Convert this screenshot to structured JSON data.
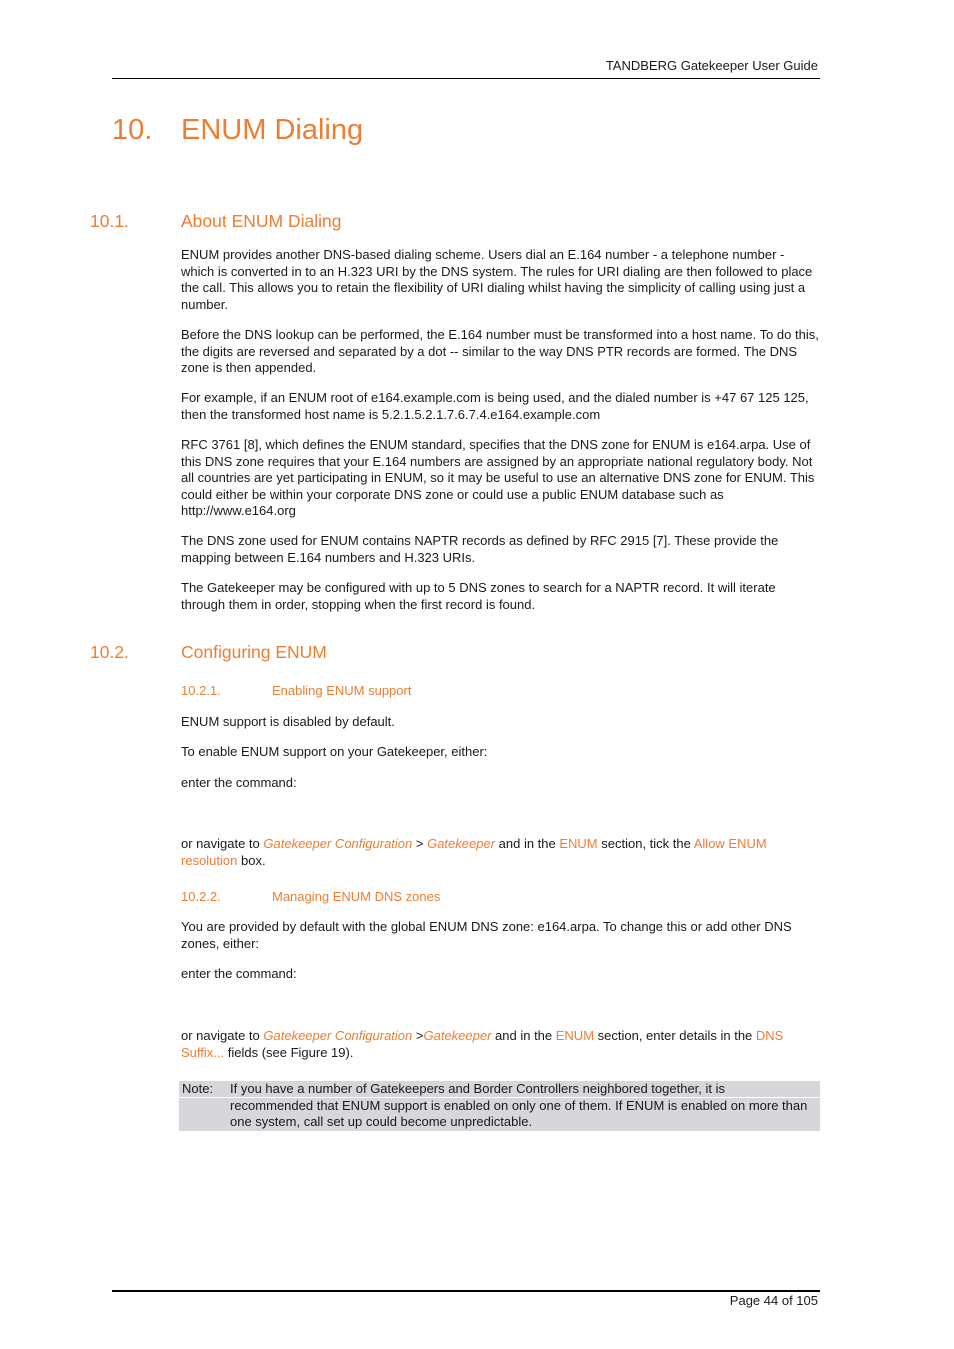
{
  "header": {
    "title": "TANDBERG Gatekeeper User Guide"
  },
  "chapter": {
    "number": "10.",
    "title": "ENUM Dialing"
  },
  "sections": {
    "about": {
      "number": "10.1.",
      "title": "About ENUM Dialing",
      "paragraphs": [
        "ENUM provides another DNS-based dialing scheme. Users dial an E.164 number - a telephone number - which is converted in to an H.323 URI by the DNS system. The rules for URI dialing are then followed to place the call. This allows you to retain the flexibility of URI dialing whilst having the simplicity of calling using just a number.",
        "Before the DNS lookup can be performed, the E.164 number must be transformed into a host name. To do this, the digits are reversed and separated by a dot -- similar to the way DNS PTR records are formed. The DNS zone is then appended.",
        "For example, if an ENUM root of e164.example.com is being used, and the dialed number is +47 67 125 125, then the transformed host name is 5.2.1.5.2.1.7.6.7.4.e164.example.com",
        "RFC 3761 [8], which defines the ENUM standard, specifies that the DNS zone for ENUM is e164.arpa. Use of this DNS zone requires that your E.164 numbers are assigned by an appropriate national regulatory body. Not all countries are yet participating in ENUM, so it may be useful to use an alternative DNS zone for ENUM. This could either be within your corporate DNS zone or could use a public ENUM database such as http://www.e164.org",
        "The DNS zone used for ENUM contains NAPTR records as defined by RFC 2915 [7]. These provide the mapping between E.164 numbers and H.323 URIs.",
        "The Gatekeeper may be configured with up to 5 DNS zones to search for a NAPTR record. It will iterate through them in order, stopping when the first record is found."
      ]
    },
    "configuring": {
      "number": "10.2.",
      "title": "Configuring ENUM",
      "enabling": {
        "number": "10.2.1.",
        "title": "Enabling ENUM support",
        "p1": "ENUM support is disabled by default.",
        "p2": "To enable ENUM support on your Gatekeeper, either:",
        "p3": "enter the command:",
        "nav": {
          "t1": "or navigate to ",
          "link1": "Gatekeeper Configuration",
          "t2": " > ",
          "link2": "Gatekeeper",
          "t3": " and in the ",
          "link3": "ENUM",
          "t4": " section, tick the ",
          "link4": "Allow ENUM resolution",
          "t5": " box."
        }
      },
      "managing": {
        "number": "10.2.2.",
        "title": "Managing ENUM DNS zones",
        "p1": "You are provided by default with the global ENUM DNS zone: e164.arpa. To change this or add other DNS zones, either:",
        "p2": "enter the command:",
        "nav": {
          "t1": "or navigate to ",
          "link1": "Gatekeeper Configuration",
          "t2": " >",
          "link2": "Gatekeeper",
          "t3": " and in the ",
          "link3": "ENUM",
          "t4": " section, enter details in the ",
          "link4": "DNS Suffix...",
          "t5": " fields (see Figure 19)."
        }
      }
    }
  },
  "note": {
    "label": "Note:",
    "lines": [
      "If you have a number of Gatekeepers and Border Controllers neighbored together, it is",
      "recommended that ENUM support is enabled on only one of them. If ENUM is enabled on more than one system, call set up could become unpredictable."
    ]
  },
  "footer": {
    "page": "Page 44 of 105"
  }
}
